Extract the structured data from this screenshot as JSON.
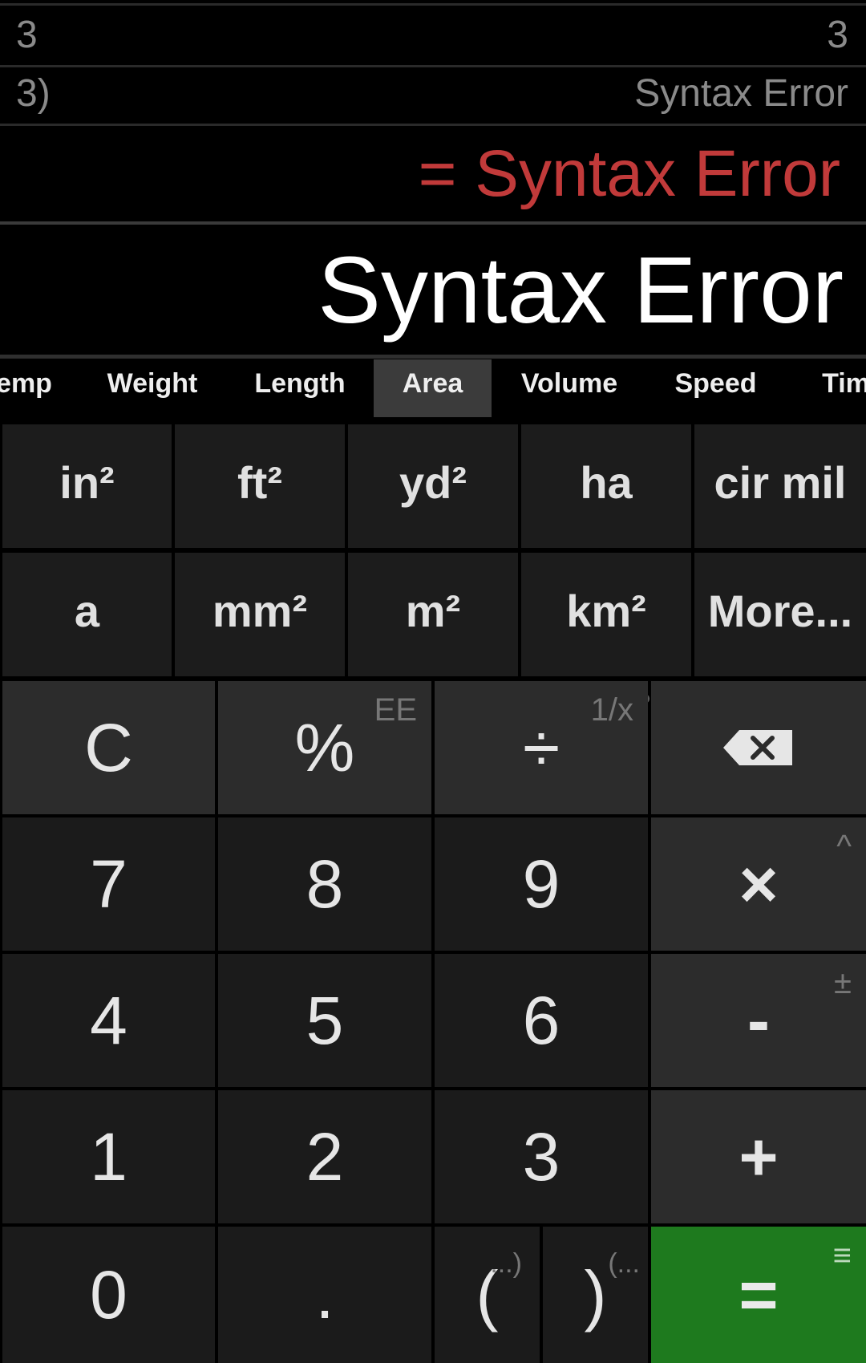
{
  "history": [
    {
      "expr": "3",
      "result": "3"
    },
    {
      "expr": "3)",
      "result": "Syntax Error"
    }
  ],
  "result_line": "= Syntax Error",
  "display": "Syntax Error",
  "colors": {
    "error_text": "#c13a3a",
    "equals_button": "#1e7a1e",
    "active_tab": "#3b3b3b"
  },
  "tabs": [
    {
      "label": "Temp",
      "visible_text": "emp"
    },
    {
      "label": "Weight"
    },
    {
      "label": "Length"
    },
    {
      "label": "Area",
      "active": true
    },
    {
      "label": "Volume"
    },
    {
      "label": "Speed"
    },
    {
      "label": "Time",
      "visible_text": "Tim"
    }
  ],
  "units_row1": [
    "in²",
    "ft²",
    "yd²",
    "ha",
    "cir mil"
  ],
  "units_row2": [
    "a",
    "mm²",
    "m²",
    "km²",
    "More..."
  ],
  "keypad": {
    "clear": "C",
    "percent": {
      "label": "%",
      "alt": "EE"
    },
    "divide": {
      "label": "÷",
      "alt": "1/x"
    },
    "backspace_icon": "backspace-icon",
    "seven": "7",
    "eight": "8",
    "nine": "9",
    "multiply": {
      "label": "×",
      "alt": "^"
    },
    "four": "4",
    "five": "5",
    "six": "6",
    "minus": {
      "label": "-",
      "alt": "±"
    },
    "one": "1",
    "two": "2",
    "three": "3",
    "plus": "+",
    "zero": "0",
    "dot": ".",
    "open_paren": {
      "label": "(",
      "alt": "...)"
    },
    "close_paren": {
      "label": ")",
      "alt": "(..."
    },
    "equals": {
      "label": "=",
      "alt": "≡"
    }
  }
}
